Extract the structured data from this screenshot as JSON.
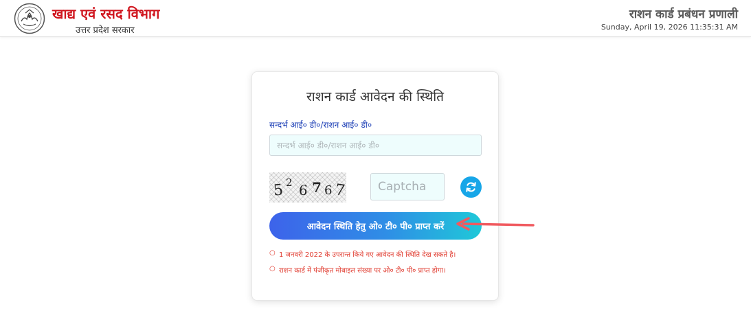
{
  "header": {
    "brand_title": "खाद्य एवं रसद विभाग",
    "brand_subtitle": "उत्तर प्रदेश सरकार",
    "system_name": "राशन कार्ड प्रबंधन प्रणाली",
    "datetime": "Sunday, April 19, 2026 11:35:31 AM",
    "emblem_icon": "up-government-emblem-icon"
  },
  "form": {
    "title": "राशन कार्ड आवेदन की स्थिति",
    "ref_label": "सन्दर्भ आई० डी०/राशन आई० डी०",
    "ref_placeholder": "सन्दर्भ आई० डी०/राशन आई० डी०",
    "ref_value": "",
    "captcha_digits": [
      "5",
      "2",
      "6",
      "7",
      "6",
      "7"
    ],
    "captcha_placeholder": "Captcha",
    "captcha_value": "",
    "refresh_icon": "refresh-icon",
    "submit_label": "आवेदन स्थिति हेतु ओ० टी० पी० प्राप्त करें",
    "notes": [
      "1 जनवरी 2022 के उपरान्त किये गए आवेदन की स्थिति देख सकते है।",
      "राशन कार्ड में पंजीकृत मोबाइल संख्या पर ओ० टी० पी० प्राप्त होगा।"
    ],
    "note_bullet": "○"
  },
  "colors": {
    "brand_red": "#d0161f",
    "label_blue": "#1a3db5",
    "note_red": "#e03a2e",
    "button_gradient_start": "#3d63ea",
    "button_gradient_end": "#1fc8d8",
    "refresh_blue": "#17a6e8",
    "annotation_arrow": "#f05a5f"
  }
}
